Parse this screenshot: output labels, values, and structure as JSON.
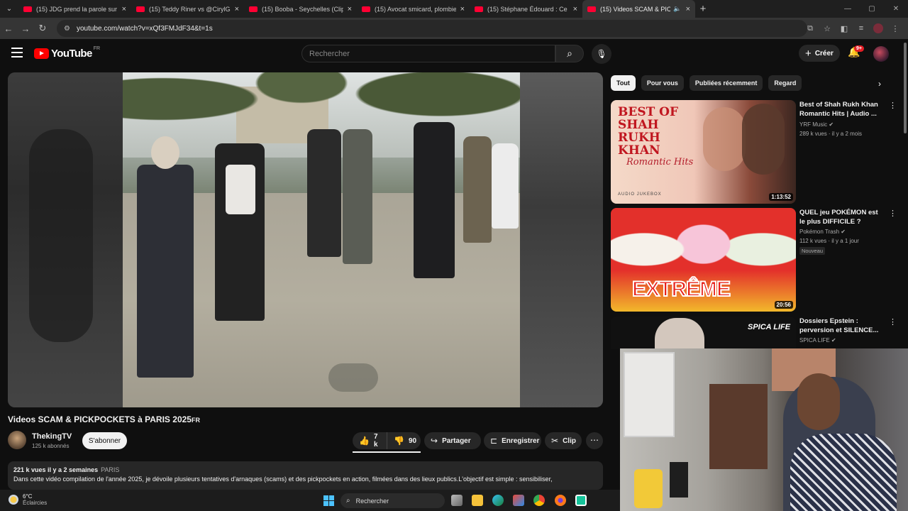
{
  "browser": {
    "tabs": [
      {
        "title": "(15) JDG prend la parole sur la",
        "active": false
      },
      {
        "title": "(15) Teddy Riner vs @CirylGane",
        "active": false
      },
      {
        "title": "(15) Booba - Seychelles (Clip Of",
        "active": false
      },
      {
        "title": "(15) Avocat smicard, plombier à",
        "active": false
      },
      {
        "title": "(15) Stéphane Édouard : Ce qui",
        "active": false
      },
      {
        "title": "(15) Videos SCAM & PICKPO",
        "active": true
      }
    ],
    "url": "youtube.com/watch?v=xQf3FMJdF34&t=1s"
  },
  "masthead": {
    "logo_text": "YouTube",
    "country": "FR",
    "search_placeholder": "Rechercher",
    "create_label": "Créer",
    "notif_count": "9+"
  },
  "video": {
    "title": "Videos SCAM & PICKPOCKETS à PARIS 2025",
    "title_badge": "FR",
    "channel": "ThekingTV",
    "subscribers": "125 k abonnés",
    "subscribe_label": "S'abonner",
    "likes": "7 k",
    "dislikes": "90",
    "share_label": "Partager",
    "save_label": "Enregistrer",
    "clip_label": "Clip",
    "views_time": "221 k vues  il y a 2 semaines",
    "location": "PARIS",
    "description": "Dans cette vidéo compilation de l'année 2025, je dévoile plusieurs tentatives d'arnaques (scams) et des pickpockets en action, filmées dans des lieux publics.L'objectif est simple : sensibiliser,"
  },
  "chips": [
    "Tout",
    "Pour vous",
    "Publiées récemment",
    "Regard"
  ],
  "recommendations": [
    {
      "title": "Best of Shah Rukh Khan Romantic Hits | Audio ...",
      "channel": "YRF Music",
      "meta": "289 k vues · il y a 2 mois",
      "duration": "1:13:52",
      "thumb_text": "BEST OF SHAH RUKH KHAN",
      "thumb_sub": "Romantic Hits",
      "thumb_foot": "AUDIO JUKEBOX",
      "badge": ""
    },
    {
      "title": "QUEL jeu POKÉMON est le plus DIFFICILE ?",
      "channel": "Pokémon Trash",
      "meta": "112 k vues · il y a 1 jour",
      "duration": "20:56",
      "thumb_text": "EXTRÊME",
      "badge": "Nouveau"
    },
    {
      "title": "Dossiers Epstein : perversion et SILENCE... ",
      "channel": "SPICA LIFE",
      "meta": "",
      "duration": "",
      "thumb_text": "SPICA LIFE",
      "badge": ""
    }
  ],
  "taskbar": {
    "temp": "6°C",
    "weather": "Éclaircies",
    "search_label": "Rechercher"
  }
}
